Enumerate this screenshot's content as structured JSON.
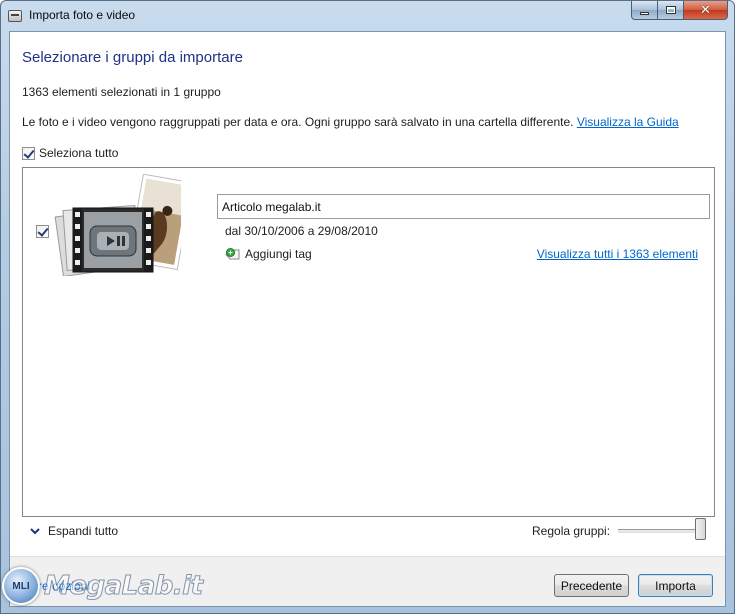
{
  "window": {
    "title": "Importa foto e video",
    "close_glyph": "✕"
  },
  "main": {
    "heading": "Selezionare i gruppi da importare",
    "selected_count": "1363 elementi selezionati in 1 gruppo",
    "info_text": "Le foto e i video vengono raggruppati per data e ora. Ogni gruppo sarà salvato in una cartella differente.",
    "help_link": "Visualizza la Guida",
    "select_all_label": "Seleziona tutto",
    "select_all_checked": true
  },
  "groups": [
    {
      "checked": true,
      "name": "Articolo megalab.it",
      "date_range": "dal 30/10/2006 a 29/08/2010",
      "add_tag_label": "Aggiungi tag",
      "view_all_link": "Visualizza tutti i 1363 elementi"
    }
  ],
  "controls": {
    "expand_all_label": "Espandi tutto",
    "adjust_groups_label": "Regola gruppi:",
    "adjust_level": 1.0
  },
  "footer": {
    "options_link": "Altre opzioni",
    "prev_button": "Precedente",
    "import_button": "Importa"
  },
  "watermark": {
    "badge": "MLI",
    "text": "MegaLab.it"
  },
  "icons": {
    "title_icon": "import-device-icon",
    "tag_icon": "add-tag-icon",
    "chevron": "chevron-down-icon"
  },
  "colors": {
    "heading": "#1e3287",
    "link": "#0066cc"
  }
}
